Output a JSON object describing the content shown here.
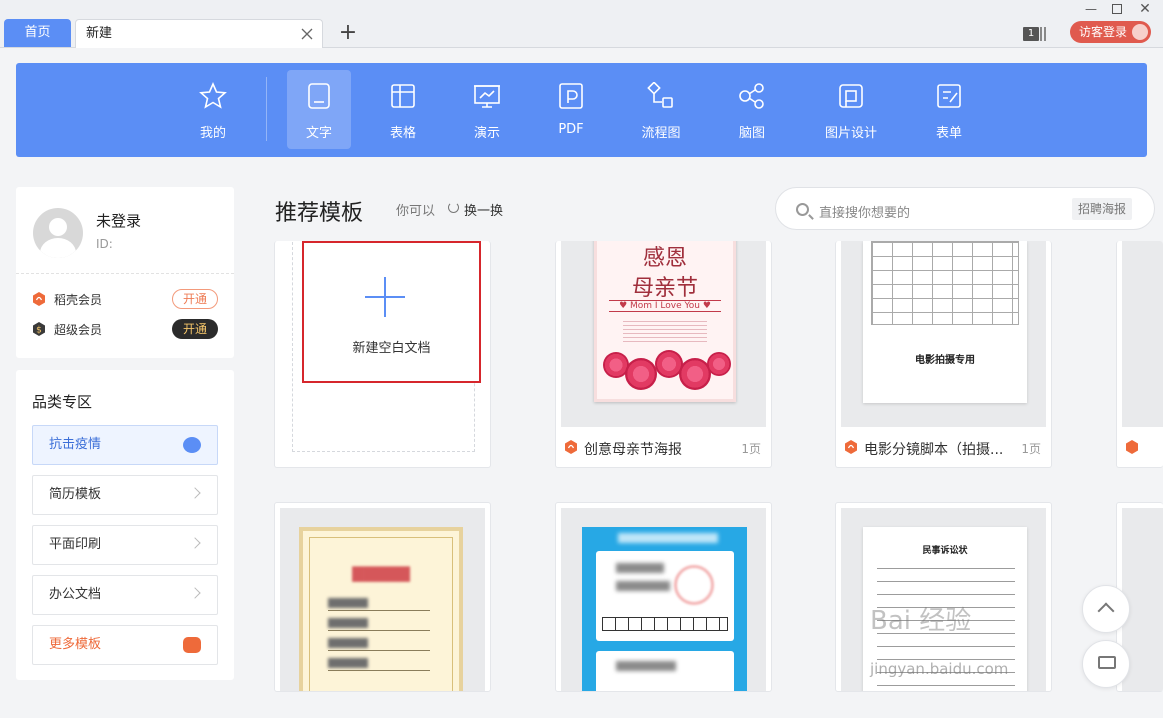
{
  "tabs": {
    "home": "首页",
    "current": "新建"
  },
  "header": {
    "count_badge": "1",
    "login_label": "访客登录"
  },
  "toolbar": {
    "items": [
      {
        "label": "我的",
        "icon": "star-icon"
      },
      {
        "label": "文字",
        "icon": "document-icon",
        "active": true
      },
      {
        "label": "表格",
        "icon": "table-icon"
      },
      {
        "label": "演示",
        "icon": "presentation-icon"
      },
      {
        "label": "PDF",
        "icon": "pdf-icon"
      },
      {
        "label": "流程图",
        "icon": "flowchart-icon"
      },
      {
        "label": "脑图",
        "icon": "mindmap-icon"
      },
      {
        "label": "图片设计",
        "icon": "image-design-icon"
      },
      {
        "label": "表单",
        "icon": "form-icon"
      }
    ],
    "accent": "#5b8ef5"
  },
  "profile": {
    "name": "未登录",
    "id_label": "ID:",
    "vip1": {
      "name": "稻壳会员",
      "button": "开通"
    },
    "vip2": {
      "name": "超级会员",
      "button": "开通"
    }
  },
  "categories": {
    "title": "品类专区",
    "items": [
      {
        "label": "抗击疫情"
      },
      {
        "label": "简历模板"
      },
      {
        "label": "平面印刷"
      },
      {
        "label": "办公文档"
      },
      {
        "label": "更多模板"
      }
    ]
  },
  "recommend": {
    "title": "推荐模板",
    "hint": "你可以",
    "refresh": "换一换"
  },
  "search": {
    "placeholder": "直接搜你想要的",
    "tag": "招聘海报"
  },
  "new_doc": {
    "label": "新建空白文档"
  },
  "templates": [
    {
      "name": "创意母亲节海报",
      "pages": "1页"
    },
    {
      "name": "电影分镜脚本（拍摄...",
      "pages": "1页"
    }
  ],
  "poster": {
    "line1": "感恩",
    "line2": "母亲节",
    "line3": "♥ Mom I Love You ♥"
  },
  "sheet": {
    "title": "电影拍摄专用"
  },
  "letter": {
    "title": "民事诉讼状"
  },
  "watermark": {
    "text": "Bai 经验",
    "sub": "jingyan.baidu.com"
  }
}
